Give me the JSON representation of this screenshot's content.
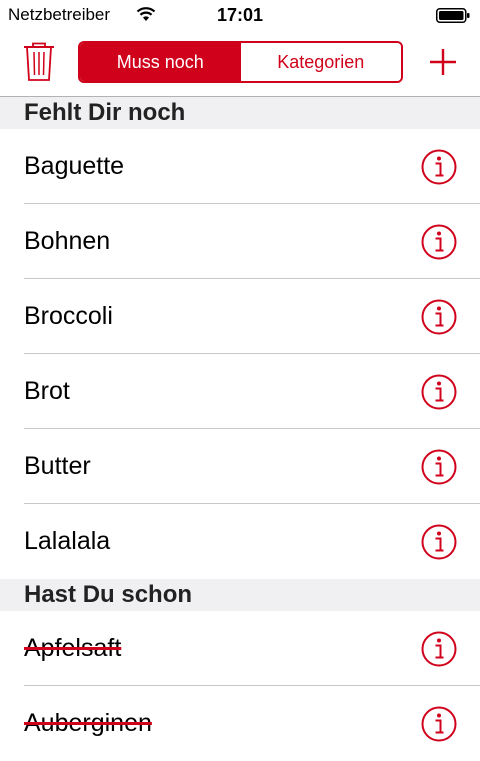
{
  "status_bar": {
    "carrier": "Netzbetreiber",
    "time": "17:01"
  },
  "navbar": {
    "segments": [
      "Muss noch",
      "Kategorien"
    ],
    "selected_segment": "Muss noch"
  },
  "sections": [
    {
      "title": "Fehlt Dir noch",
      "items": [
        "Baguette",
        "Bohnen",
        "Broccoli",
        "Brot",
        "Butter",
        "Lalalala"
      ]
    },
    {
      "title": "Hast Du schon",
      "items": [
        "Apfelsaft",
        "Auberginen"
      ]
    }
  ],
  "colors": {
    "accent": "#d0021b",
    "section_background": "#f0f0f2",
    "separator": "#c8c7cc"
  },
  "icons": {
    "trash": "trash-icon",
    "add": "plus-icon",
    "info": "info-icon",
    "wifi": "wifi-icon",
    "battery": "battery-icon"
  }
}
